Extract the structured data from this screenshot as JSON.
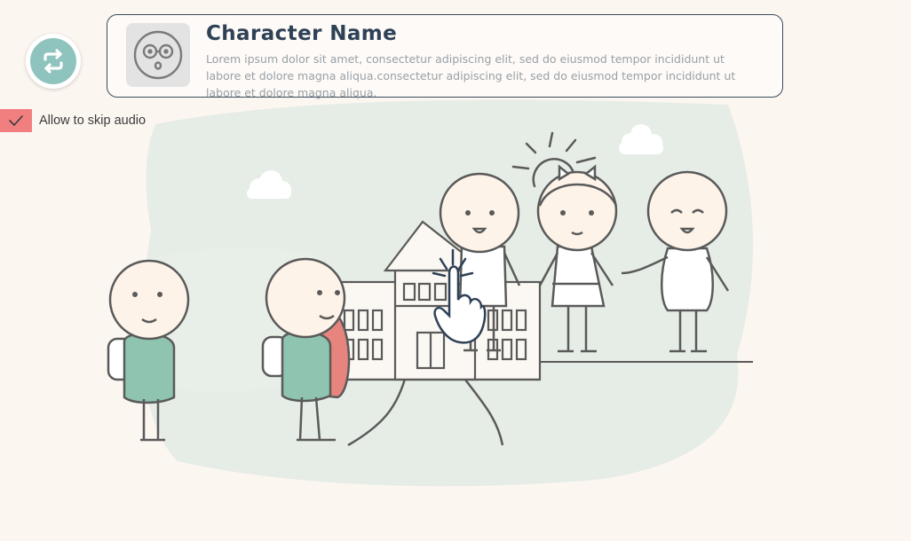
{
  "header": {
    "character_name": "Character Name",
    "character_description": "Lorem ipsum dolor sit amet, consectetur adipiscing elit, sed do eiusmod tempor incididunt ut labore et dolore magna aliqua.consectetur adipiscing elit, sed do eiusmod tempor incididunt ut labore et dolore magna aliqua."
  },
  "controls": {
    "skip_audio_label": "Allow to skip audio",
    "skip_audio_checked": true
  },
  "icons": {
    "replay": "repeat-arrows-icon",
    "avatar": "glasses-face-icon",
    "checkbox": "checkmark-icon",
    "pointer": "hand-pointer-icon"
  },
  "colors": {
    "background": "#fcf6f1",
    "teal": "#8ec4bd",
    "coral": "#f27f7f",
    "heading": "#2f4156"
  }
}
